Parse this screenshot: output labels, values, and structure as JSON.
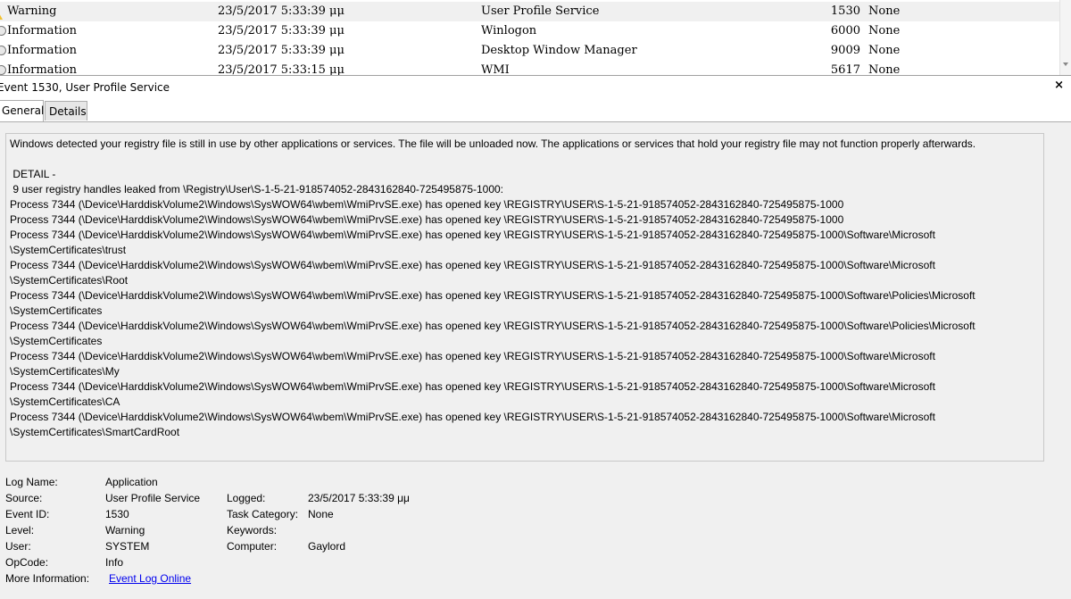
{
  "events": [
    {
      "level": "Warning",
      "level_icon": "warning-icon",
      "date": "23/5/2017 5:33:39 μμ",
      "source": "User Profile Service",
      "event_id": "1530",
      "task": "None",
      "selected": true
    },
    {
      "level": "Information",
      "level_icon": "info-icon",
      "date": "23/5/2017 5:33:39 μμ",
      "source": "Winlogon",
      "event_id": "6000",
      "task": "None",
      "selected": false
    },
    {
      "level": "Information",
      "level_icon": "info-icon",
      "date": "23/5/2017 5:33:39 μμ",
      "source": "Desktop Window Manager",
      "event_id": "9009",
      "task": "None",
      "selected": false
    },
    {
      "level": "Information",
      "level_icon": "info-icon",
      "date": "23/5/2017 5:33:15 μμ",
      "source": "WMI",
      "event_id": "5617",
      "task": "None",
      "selected": false
    }
  ],
  "detail": {
    "title": "Event 1530, User Profile Service",
    "tabs": [
      "General",
      "Details"
    ],
    "description": "Windows detected your registry file is still in use by other applications or services. The file will be unloaded now. The applications or services that hold your registry file may not function properly afterwards.\n\n DETAIL -\n 9 user registry handles leaked from \\Registry\\User\\S-1-5-21-918574052-2843162840-725495875-1000:\nProcess 7344 (\\Device\\HarddiskVolume2\\Windows\\SysWOW64\\wbem\\WmiPrvSE.exe) has opened key \\REGISTRY\\USER\\S-1-5-21-918574052-2843162840-725495875-1000\nProcess 7344 (\\Device\\HarddiskVolume2\\Windows\\SysWOW64\\wbem\\WmiPrvSE.exe) has opened key \\REGISTRY\\USER\\S-1-5-21-918574052-2843162840-725495875-1000\nProcess 7344 (\\Device\\HarddiskVolume2\\Windows\\SysWOW64\\wbem\\WmiPrvSE.exe) has opened key \\REGISTRY\\USER\\S-1-5-21-918574052-2843162840-725495875-1000\\Software\\Microsoft\n\\SystemCertificates\\trust\nProcess 7344 (\\Device\\HarddiskVolume2\\Windows\\SysWOW64\\wbem\\WmiPrvSE.exe) has opened key \\REGISTRY\\USER\\S-1-5-21-918574052-2843162840-725495875-1000\\Software\\Microsoft\n\\SystemCertificates\\Root\nProcess 7344 (\\Device\\HarddiskVolume2\\Windows\\SysWOW64\\wbem\\WmiPrvSE.exe) has opened key \\REGISTRY\\USER\\S-1-5-21-918574052-2843162840-725495875-1000\\Software\\Policies\\Microsoft\n\\SystemCertificates\nProcess 7344 (\\Device\\HarddiskVolume2\\Windows\\SysWOW64\\wbem\\WmiPrvSE.exe) has opened key \\REGISTRY\\USER\\S-1-5-21-918574052-2843162840-725495875-1000\\Software\\Policies\\Microsoft\n\\SystemCertificates\nProcess 7344 (\\Device\\HarddiskVolume2\\Windows\\SysWOW64\\wbem\\WmiPrvSE.exe) has opened key \\REGISTRY\\USER\\S-1-5-21-918574052-2843162840-725495875-1000\\Software\\Microsoft\n\\SystemCertificates\\My\nProcess 7344 (\\Device\\HarddiskVolume2\\Windows\\SysWOW64\\wbem\\WmiPrvSE.exe) has opened key \\REGISTRY\\USER\\S-1-5-21-918574052-2843162840-725495875-1000\\Software\\Microsoft\n\\SystemCertificates\\CA\nProcess 7344 (\\Device\\HarddiskVolume2\\Windows\\SysWOW64\\wbem\\WmiPrvSE.exe) has opened key \\REGISTRY\\USER\\S-1-5-21-918574052-2843162840-725495875-1000\\Software\\Microsoft\n\\SystemCertificates\\SmartCardRoot",
    "properties": {
      "log_name_label": "Log Name:",
      "log_name": "Application",
      "source_label": "Source:",
      "source": "User Profile Service",
      "logged_label": "Logged:",
      "logged": "23/5/2017 5:33:39 μμ",
      "event_id_label": "Event ID:",
      "event_id": "1530",
      "task_category_label": "Task Category:",
      "task_category": "None",
      "level_label": "Level:",
      "level": "Warning",
      "keywords_label": "Keywords:",
      "keywords": "",
      "user_label": "User:",
      "user": "SYSTEM",
      "computer_label": "Computer:",
      "computer": "Gaylord",
      "opcode_label": "OpCode:",
      "opcode": "Info",
      "more_info_label": "More Information:",
      "more_info_link": "Event Log Online"
    }
  },
  "colors": {
    "link": "#0000ee",
    "panel_bg": "#f0f0f0",
    "warning": "#f2c230"
  }
}
